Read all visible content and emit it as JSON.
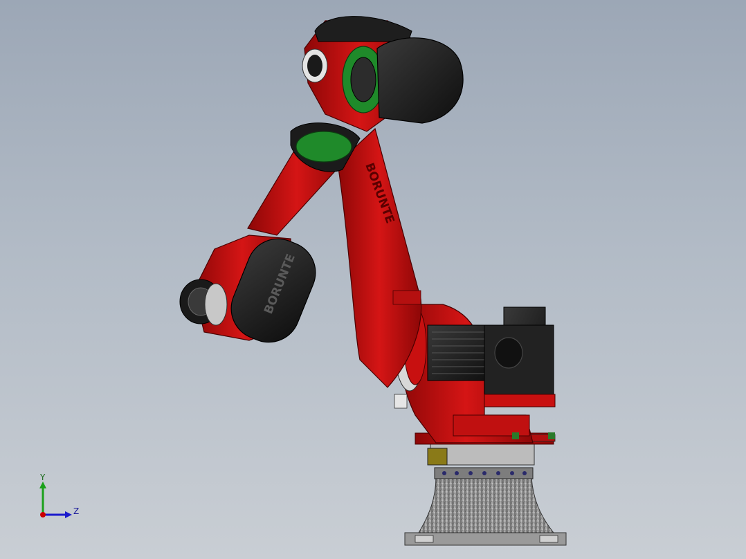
{
  "colors": {
    "background_top": "#9ca7b6",
    "background_bottom": "#c9ced4",
    "robot_red": "#c81010",
    "robot_dark_red": "#7a0606",
    "cover_black": "#1e1e1e",
    "flange_green": "#1f8a2a",
    "pedestal_gray": "#8f8f8f",
    "axis_x": "#cc0000",
    "axis_y": "#1aa01a",
    "axis_z": "#1a1acc"
  },
  "robot": {
    "brand_text_cover": "BORUNTE",
    "brand_text_arm": "BORUNTE"
  },
  "triad": {
    "y_label": "Y",
    "z_label": "Z"
  }
}
